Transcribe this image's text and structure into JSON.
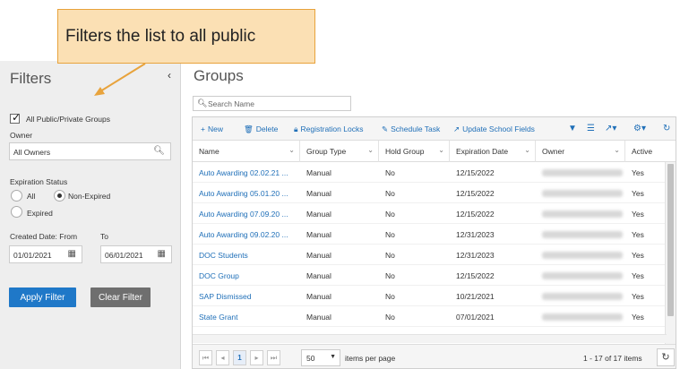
{
  "callout": {
    "text": "Filters the list to all public"
  },
  "filters": {
    "title": "Filters",
    "collapse_icon": "‹",
    "all_groups_label": "All Public/Private Groups",
    "owner_label": "Owner",
    "owner_value": "All Owners",
    "expiration_status_label": "Expiration Status",
    "radio_all": "All",
    "radio_non_expired": "Non-Expired",
    "radio_expired": "Expired",
    "created_from_label": "Created Date: From",
    "created_to_label": "To",
    "from_date": "01/01/2021",
    "to_date": "06/01/2021",
    "apply_label": "Apply Filter",
    "clear_label": "Clear Filter"
  },
  "groups": {
    "title": "Groups",
    "search_placeholder": "Search Name",
    "toolbar": {
      "new": "New",
      "delete": "Delete",
      "registration_locks": "Registration Locks",
      "schedule_task": "Schedule Task",
      "update_school_fields": "Update School Fields"
    },
    "columns": [
      "Name",
      "Group Type",
      "Hold Group",
      "Expiration Date",
      "Owner",
      "Active"
    ],
    "rows": [
      {
        "name": "Auto Awarding 02.02.21 ...",
        "type": "Manual",
        "hold": "No",
        "exp": "12/15/2022",
        "active": "Yes"
      },
      {
        "name": "Auto Awarding 05.01.20 ...",
        "type": "Manual",
        "hold": "No",
        "exp": "12/15/2022",
        "active": "Yes"
      },
      {
        "name": "Auto Awarding 07.09.20 ...",
        "type": "Manual",
        "hold": "No",
        "exp": "12/15/2022",
        "active": "Yes"
      },
      {
        "name": "Auto Awarding 09.02.20 ...",
        "type": "Manual",
        "hold": "No",
        "exp": "12/31/2023",
        "active": "Yes"
      },
      {
        "name": "DOC Students",
        "type": "Manual",
        "hold": "No",
        "exp": "12/31/2023",
        "active": "Yes"
      },
      {
        "name": "DOC Group",
        "type": "Manual",
        "hold": "No",
        "exp": "12/15/2022",
        "active": "Yes"
      },
      {
        "name": "SAP Dismissed",
        "type": "Manual",
        "hold": "No",
        "exp": "10/21/2021",
        "active": "Yes"
      },
      {
        "name": "State Grant",
        "type": "Manual",
        "hold": "No",
        "exp": "07/01/2021",
        "active": "Yes"
      }
    ],
    "pager": {
      "current_page": "1",
      "per_page": "50",
      "per_page_label": "items per page",
      "range": "1 - 17 of 17 items"
    }
  }
}
